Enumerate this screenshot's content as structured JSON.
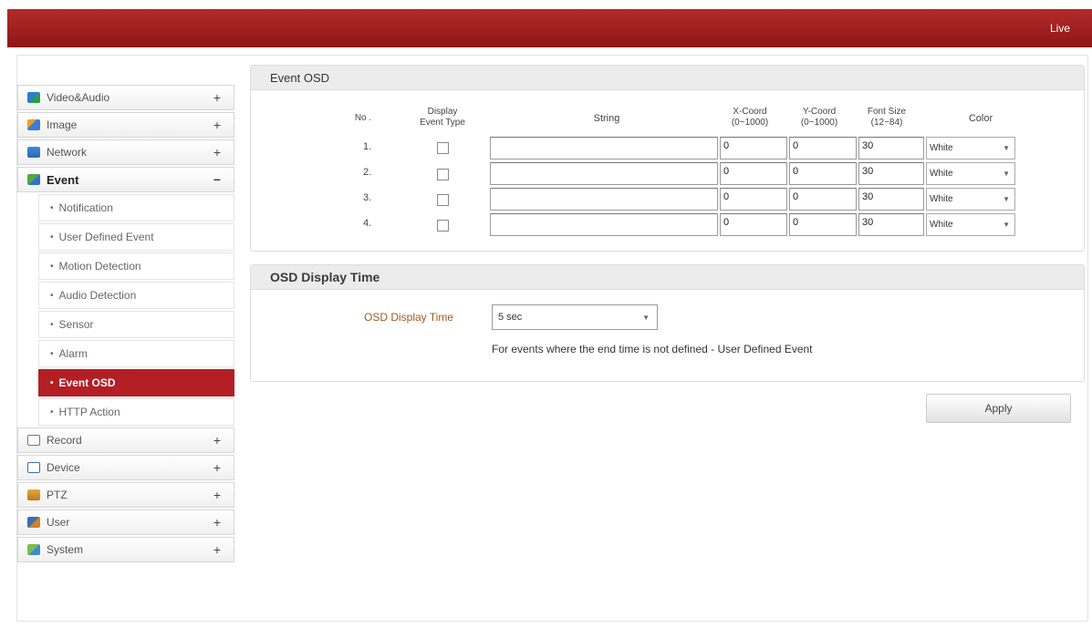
{
  "header": {
    "live_label": "Live"
  },
  "sidebar": {
    "items": [
      {
        "label": "Video&Audio",
        "toggle": "+",
        "icon": "video-audio-icon"
      },
      {
        "label": "Image",
        "toggle": "+",
        "icon": "image-icon"
      },
      {
        "label": "Network",
        "toggle": "+",
        "icon": "network-icon"
      },
      {
        "label": "Event",
        "toggle": "−",
        "icon": "event-icon"
      }
    ],
    "event_subitems": [
      "Notification",
      "User Defined Event",
      "Motion Detection",
      "Audio Detection",
      "Sensor",
      "Alarm",
      "Event OSD",
      "HTTP Action"
    ],
    "active_subitem": "Event OSD",
    "lower_items": [
      {
        "label": "Record",
        "toggle": "+",
        "icon": "record-icon"
      },
      {
        "label": "Device",
        "toggle": "+",
        "icon": "device-icon"
      },
      {
        "label": "PTZ",
        "toggle": "+",
        "icon": "ptz-icon"
      },
      {
        "label": "User",
        "toggle": "+",
        "icon": "user-icon"
      },
      {
        "label": "System",
        "toggle": "+",
        "icon": "system-icon"
      }
    ]
  },
  "event_osd": {
    "title": "Event OSD",
    "headers": {
      "no": "No .",
      "display_event_type_1": "Display",
      "display_event_type_2": "Event Type",
      "string": "String",
      "x_coord_1": "X-Coord",
      "x_coord_2": "(0~1000)",
      "y_coord_1": "Y-Coord",
      "y_coord_2": "(0~1000)",
      "font_size_1": "Font Size",
      "font_size_2": "(12~84)",
      "color": "Color"
    },
    "rows": [
      {
        "no": "1.",
        "display": false,
        "string": "",
        "x": "0",
        "y": "0",
        "font_size": "30",
        "color": "White"
      },
      {
        "no": "2.",
        "display": false,
        "string": "",
        "x": "0",
        "y": "0",
        "font_size": "30",
        "color": "White"
      },
      {
        "no": "3.",
        "display": false,
        "string": "",
        "x": "0",
        "y": "0",
        "font_size": "30",
        "color": "White"
      },
      {
        "no": "4.",
        "display": false,
        "string": "",
        "x": "0",
        "y": "0",
        "font_size": "30",
        "color": "White"
      }
    ]
  },
  "osd_display_time": {
    "title": "OSD Display Time",
    "label": "OSD Display Time",
    "value": "5 sec",
    "note": "For events where the end time is not defined - User Defined Event"
  },
  "apply_label": "Apply",
  "colors": {
    "accent": "#b31f24",
    "header_bar": "#a11f1f",
    "label_brown": "#a05a23"
  }
}
